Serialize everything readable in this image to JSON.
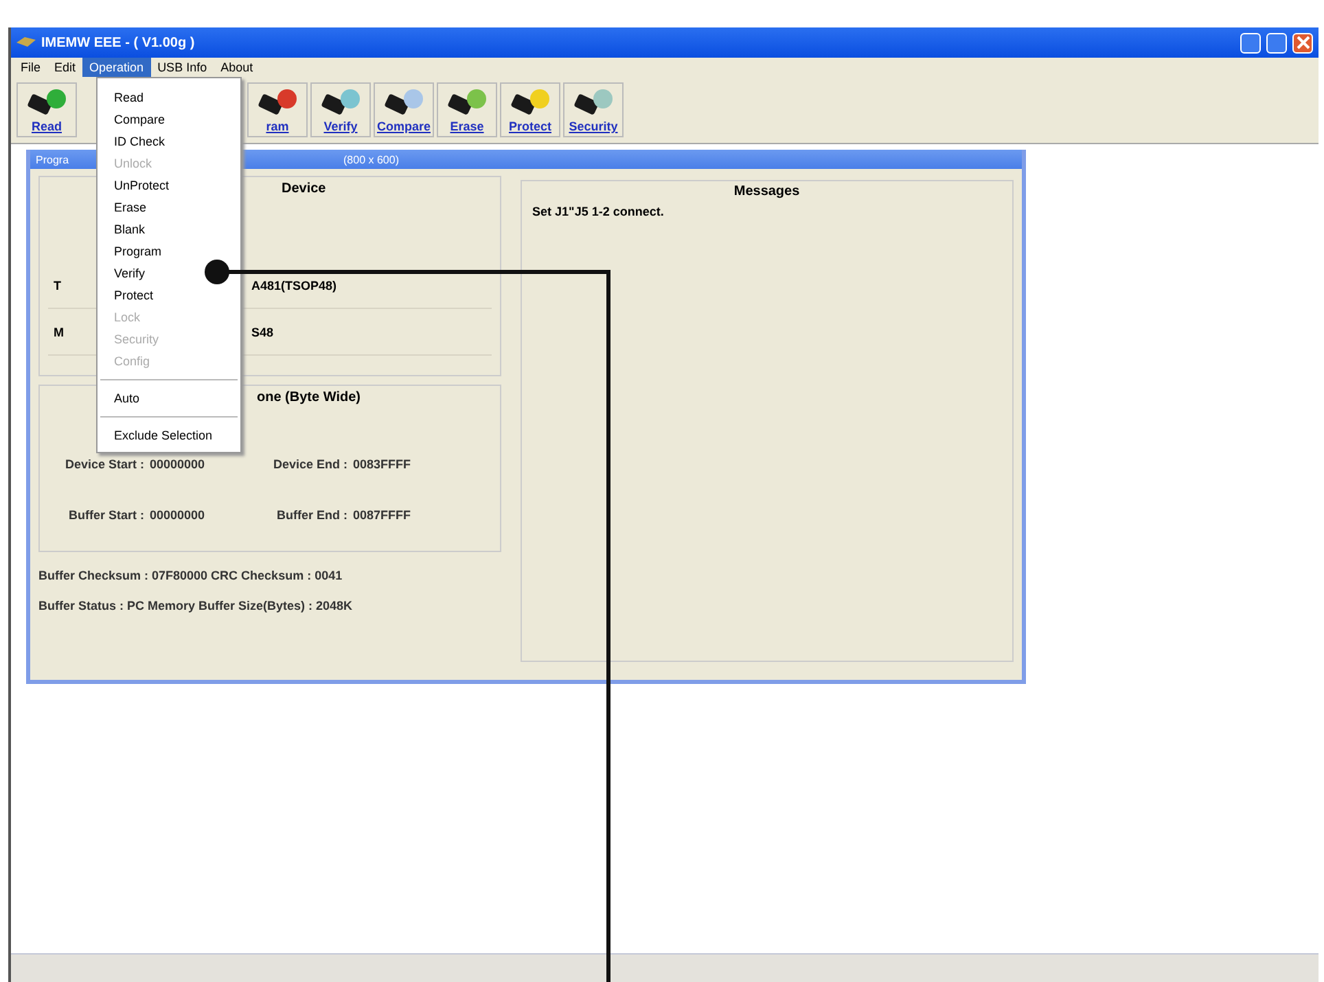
{
  "window": {
    "title": "IMEMW EEE - ( V1.00g )"
  },
  "menu_bar": [
    {
      "label": "File",
      "selected": false
    },
    {
      "label": "Edit",
      "selected": false
    },
    {
      "label": "Operation",
      "selected": true
    },
    {
      "label": "USB Info",
      "selected": false
    },
    {
      "label": "About",
      "selected": false
    }
  ],
  "dropdown": [
    {
      "kind": "item",
      "label": "Read",
      "disabled": false
    },
    {
      "kind": "item",
      "label": "Compare",
      "disabled": false
    },
    {
      "kind": "item",
      "label": "ID Check",
      "disabled": false
    },
    {
      "kind": "item",
      "label": "Unlock",
      "disabled": true
    },
    {
      "kind": "item",
      "label": "UnProtect",
      "disabled": false
    },
    {
      "kind": "item",
      "label": "Erase",
      "disabled": false
    },
    {
      "kind": "item",
      "label": "Blank",
      "disabled": false
    },
    {
      "kind": "item",
      "label": "Program",
      "disabled": false
    },
    {
      "kind": "item",
      "label": "Verify",
      "disabled": false
    },
    {
      "kind": "item",
      "label": "Protect",
      "disabled": false
    },
    {
      "kind": "item",
      "label": "Lock",
      "disabled": true
    },
    {
      "kind": "item",
      "label": "Security",
      "disabled": true
    },
    {
      "kind": "item",
      "label": "Config",
      "disabled": true
    },
    {
      "kind": "separator"
    },
    {
      "kind": "item",
      "label": "Auto",
      "disabled": false
    },
    {
      "kind": "separator"
    },
    {
      "kind": "item",
      "label": "Exclude Selection",
      "disabled": false
    }
  ],
  "toolbar": [
    {
      "label": "Read",
      "color": "#2fae3a"
    },
    {
      "label": "ram",
      "color": "#d83a2a"
    },
    {
      "label": "Verify",
      "color": "#7cc4d0"
    },
    {
      "label": "Compare",
      "color": "#a9c6e8"
    },
    {
      "label": "Erase",
      "color": "#7cc24a"
    },
    {
      "label": "Protect",
      "color": "#f0d020"
    },
    {
      "label": "Security",
      "color": "#9cc8c0"
    }
  ],
  "child_window": {
    "title": "Progra",
    "title_right": "(800 x 600)",
    "device": {
      "heading": "Device",
      "rows": [
        {
          "label": "T",
          "value": "A481(TSOP48)"
        },
        {
          "label": "M",
          "value": "S48"
        }
      ]
    },
    "memory_zone": {
      "heading": "one (Byte Wide)",
      "rows": [
        [
          {
            "label": "Device Start :",
            "value": "00000000"
          },
          {
            "label": "Device End :",
            "value": "0083FFFF"
          }
        ],
        [
          {
            "label": "Buffer Start :",
            "value": "00000000"
          },
          {
            "label": "Buffer End :",
            "value": "0087FFFF"
          }
        ]
      ]
    },
    "status_lines": [
      "Buffer Checksum : 07F80000   CRC Checksum : 0041",
      "Buffer Status : PC Memory   Buffer Size(Bytes) : 2048K"
    ],
    "messages": {
      "heading": "Messages",
      "lines": [
        "Set J1\"J5 1-2 connect."
      ]
    }
  }
}
